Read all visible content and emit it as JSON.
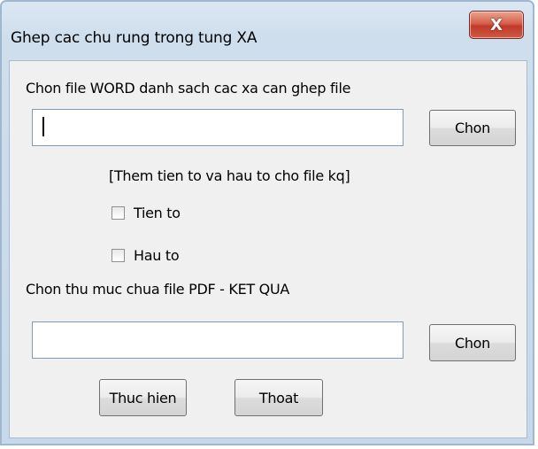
{
  "window": {
    "title": "Ghep cac chu rung trong tung XA",
    "close_label": "X"
  },
  "word_file": {
    "label": "Chon file WORD danh sach cac xa can ghep file",
    "value": "",
    "button": "Chon"
  },
  "affix": {
    "heading": "[Them tien to va hau to cho file kq]",
    "prefix_label": "Tien to",
    "prefix_checked": false,
    "suffix_label": "Hau to",
    "suffix_checked": false
  },
  "output_folder": {
    "label": "Chon thu muc chua file PDF - KET QUA",
    "value": "",
    "button": "Chon"
  },
  "actions": {
    "run": "Thuc hien",
    "exit": "Thoat"
  }
}
